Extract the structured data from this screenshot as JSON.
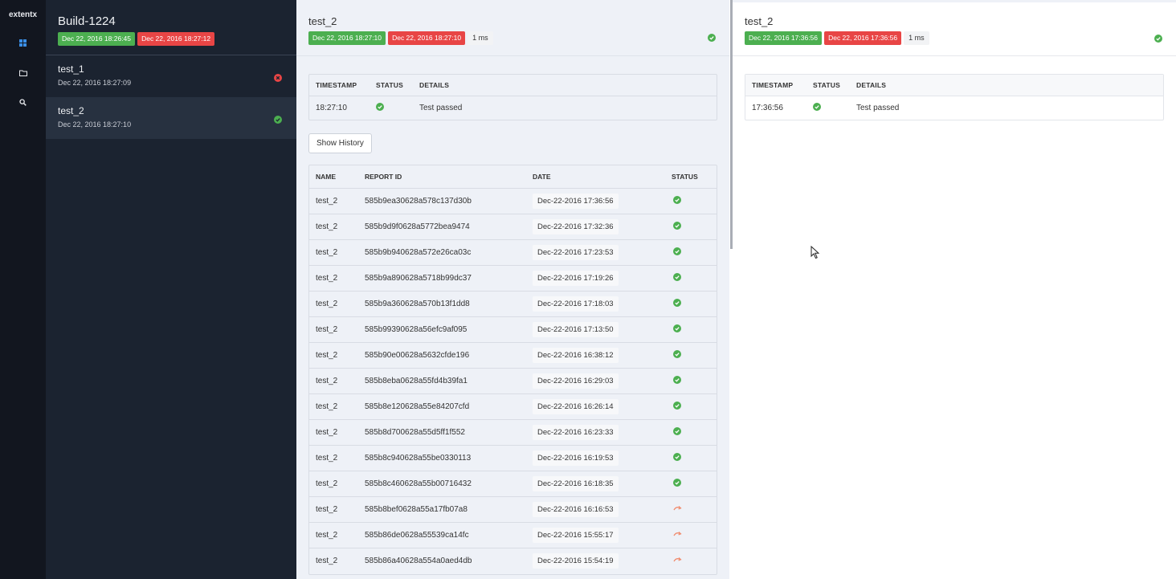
{
  "nav": {
    "brand": "extentx",
    "items": [
      {
        "icon": "dashboard-icon",
        "active": true
      },
      {
        "icon": "folder-icon",
        "active": false
      },
      {
        "icon": "search-icon",
        "active": false
      }
    ]
  },
  "build": {
    "title": "Build-1224",
    "start": "Dec 22, 2016 18:26:45",
    "end": "Dec 22, 2016 18:27:12"
  },
  "tests": [
    {
      "name": "test_1",
      "time": "Dec 22, 2016 18:27:09",
      "status": "fail"
    },
    {
      "name": "test_2",
      "time": "Dec 22, 2016 18:27:10",
      "status": "pass"
    }
  ],
  "detail": {
    "title": "test_2",
    "start": "Dec 22, 2016 18:27:10",
    "end": "Dec 22, 2016 18:27:10",
    "duration": "1 ms",
    "log_headers": [
      "TIMESTAMP",
      "STATUS",
      "DETAILS"
    ],
    "log": [
      {
        "timestamp": "18:27:10",
        "status": "pass",
        "details": "Test passed"
      }
    ],
    "history_button": "Show History",
    "history_headers": [
      "NAME",
      "REPORT ID",
      "DATE",
      "STATUS"
    ],
    "history": [
      {
        "name": "test_2",
        "id": "585b9ea30628a578c137d30b",
        "date": "Dec-22-2016 17:36:56",
        "status": "pass"
      },
      {
        "name": "test_2",
        "id": "585b9d9f0628a5772bea9474",
        "date": "Dec-22-2016 17:32:36",
        "status": "pass"
      },
      {
        "name": "test_2",
        "id": "585b9b940628a572e26ca03c",
        "date": "Dec-22-2016 17:23:53",
        "status": "pass"
      },
      {
        "name": "test_2",
        "id": "585b9a890628a5718b99dc37",
        "date": "Dec-22-2016 17:19:26",
        "status": "pass"
      },
      {
        "name": "test_2",
        "id": "585b9a360628a570b13f1dd8",
        "date": "Dec-22-2016 17:18:03",
        "status": "pass"
      },
      {
        "name": "test_2",
        "id": "585b99390628a56efc9af095",
        "date": "Dec-22-2016 17:13:50",
        "status": "pass"
      },
      {
        "name": "test_2",
        "id": "585b90e00628a5632cfde196",
        "date": "Dec-22-2016 16:38:12",
        "status": "pass"
      },
      {
        "name": "test_2",
        "id": "585b8eba0628a55fd4b39fa1",
        "date": "Dec-22-2016 16:29:03",
        "status": "pass"
      },
      {
        "name": "test_2",
        "id": "585b8e120628a55e84207cfd",
        "date": "Dec-22-2016 16:26:14",
        "status": "pass"
      },
      {
        "name": "test_2",
        "id": "585b8d700628a55d5ff1f552",
        "date": "Dec-22-2016 16:23:33",
        "status": "pass"
      },
      {
        "name": "test_2",
        "id": "585b8c940628a55be0330113",
        "date": "Dec-22-2016 16:19:53",
        "status": "pass"
      },
      {
        "name": "test_2",
        "id": "585b8c460628a55b00716432",
        "date": "Dec-22-2016 16:18:35",
        "status": "pass"
      },
      {
        "name": "test_2",
        "id": "585b8bef0628a55a17fb07a8",
        "date": "Dec-22-2016 16:16:53",
        "status": "skip"
      },
      {
        "name": "test_2",
        "id": "585b86de0628a55539ca14fc",
        "date": "Dec-22-2016 15:55:17",
        "status": "skip"
      },
      {
        "name": "test_2",
        "id": "585b86a40628a554a0aed4db",
        "date": "Dec-22-2016 15:54:19",
        "status": "skip"
      }
    ]
  },
  "compare": {
    "title": "test_2",
    "start": "Dec 22, 2016 17:36:56",
    "end": "Dec 22, 2016 17:36:56",
    "duration": "1 ms",
    "log_headers": [
      "TIMESTAMP",
      "STATUS",
      "DETAILS"
    ],
    "log": [
      {
        "timestamp": "17:36:56",
        "status": "pass",
        "details": "Test passed"
      }
    ]
  },
  "colors": {
    "pass": "#4caf50",
    "fail": "#e84545",
    "skip": "#f08a6c",
    "accent": "#3b8fe6"
  }
}
